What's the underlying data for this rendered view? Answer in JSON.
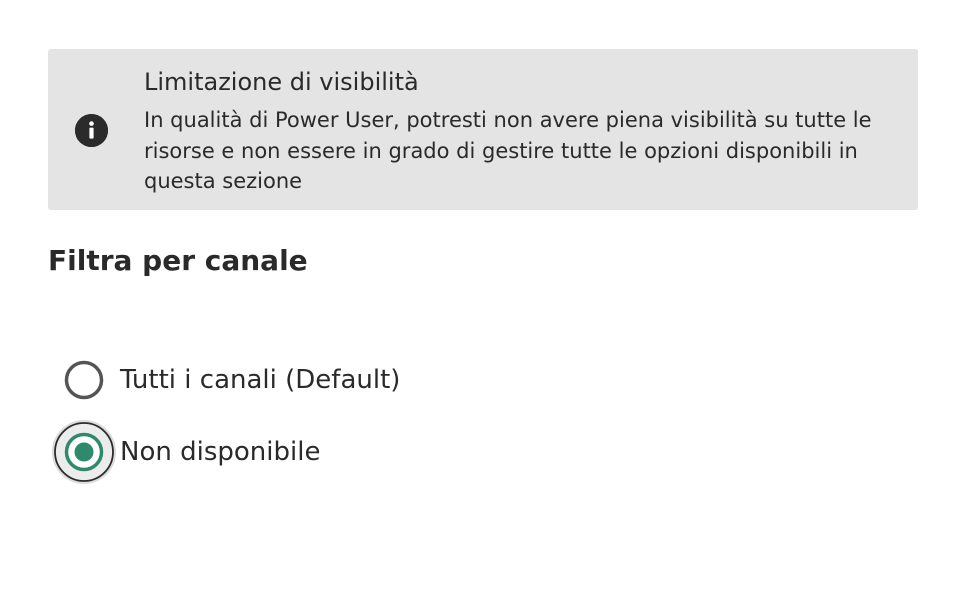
{
  "notice": {
    "icon": "info-icon",
    "title": "Limitazione di visibilità",
    "text": "In qualità di Power User, potresti non avere piena visibilità su tutte le risorse e non essere in grado di gestire tutte le opzioni disponibili in questa sezione"
  },
  "filter": {
    "title": "Filtra per canale",
    "options": [
      {
        "label": "Tutti i canali (Default)",
        "selected": false
      },
      {
        "label": "Non disponibile",
        "selected": true
      }
    ]
  },
  "colors": {
    "accent": "#2e8a6b",
    "notice_bg": "#e3e4e3",
    "text": "#2a2a2a"
  }
}
